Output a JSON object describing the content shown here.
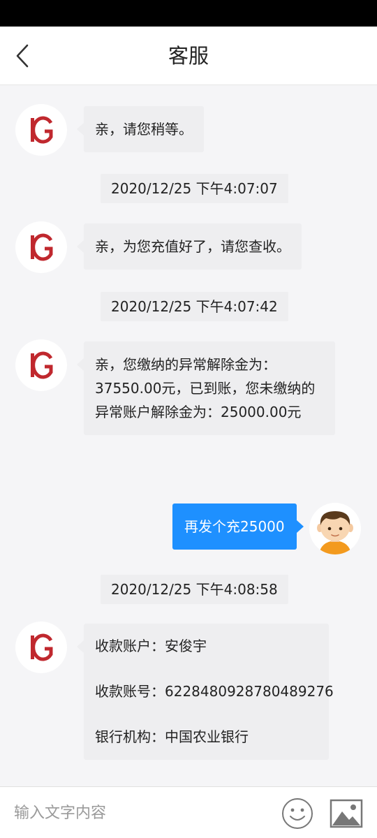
{
  "header": {
    "title": "客服"
  },
  "messages": [
    {
      "kind": "agent",
      "lines": [
        "亲，请您稍等。"
      ]
    },
    {
      "kind": "timestamp",
      "text": "2020/12/25 下午4:07:07"
    },
    {
      "kind": "agent",
      "lines": [
        "亲，为您充值好了，请您查收。"
      ]
    },
    {
      "kind": "timestamp",
      "text": "2020/12/25 下午4:07:42"
    },
    {
      "kind": "agent",
      "lines": [
        "亲，您缴纳的异常解除金为：",
        "37550.00元，已到账，您未缴纳的",
        "异常账户解除金为：25000.00元"
      ]
    },
    {
      "kind": "user",
      "lines": [
        "再发个充25000"
      ]
    },
    {
      "kind": "timestamp",
      "text": "2020/12/25 下午4:08:58"
    },
    {
      "kind": "agent",
      "lines": [
        "收款账户：安俊宇",
        "",
        "收款账号：6228480928780489276",
        "",
        "银行机构：中国农业银行"
      ]
    }
  ],
  "agent_avatar": {
    "logo_text": "IG",
    "color": "#c0282e"
  },
  "input_bar": {
    "placeholder": "输入文字内容",
    "emoji_icon": "smiley-face-icon",
    "image_icon": "image-picture-icon"
  },
  "colors": {
    "user_bubble": "#1e90ff",
    "agent_bubble": "#eeeef0",
    "background": "#f5f5f7"
  }
}
